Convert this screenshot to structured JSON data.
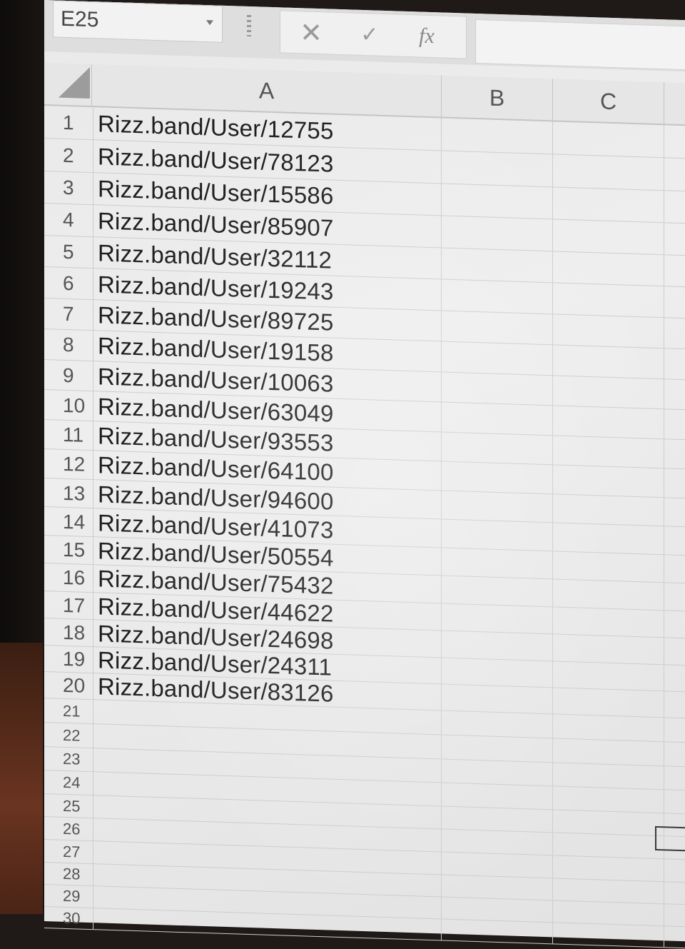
{
  "formula_bar": {
    "name_box": "E25",
    "fx_label": "fx",
    "formula_value": ""
  },
  "columns": [
    "A",
    "B",
    "C"
  ],
  "rows": [
    {
      "num": "1",
      "a": "Rizz.band/User/12755"
    },
    {
      "num": "2",
      "a": "Rizz.band/User/78123"
    },
    {
      "num": "3",
      "a": "Rizz.band/User/15586"
    },
    {
      "num": "4",
      "a": "Rizz.band/User/85907"
    },
    {
      "num": "5",
      "a": "Rizz.band/User/32112"
    },
    {
      "num": "6",
      "a": "Rizz.band/User/19243"
    },
    {
      "num": "7",
      "a": "Rizz.band/User/89725"
    },
    {
      "num": "8",
      "a": "Rizz.band/User/19158"
    },
    {
      "num": "9",
      "a": "Rizz.band/User/10063"
    },
    {
      "num": "10",
      "a": "Rizz.band/User/63049"
    },
    {
      "num": "11",
      "a": "Rizz.band/User/93553"
    },
    {
      "num": "12",
      "a": "Rizz.band/User/64100"
    },
    {
      "num": "13",
      "a": "Rizz.band/User/94600"
    },
    {
      "num": "14",
      "a": "Rizz.band/User/41073"
    },
    {
      "num": "15",
      "a": "Rizz.band/User/50554"
    },
    {
      "num": "16",
      "a": "Rizz.band/User/75432"
    },
    {
      "num": "17",
      "a": "Rizz.band/User/44622"
    },
    {
      "num": "18",
      "a": "Rizz.band/User/24698"
    },
    {
      "num": "19",
      "a": "Rizz.band/User/24311"
    },
    {
      "num": "20",
      "a": "Rizz.band/User/83126"
    },
    {
      "num": "21",
      "a": ""
    },
    {
      "num": "22",
      "a": ""
    },
    {
      "num": "23",
      "a": ""
    },
    {
      "num": "24",
      "a": ""
    },
    {
      "num": "25",
      "a": ""
    },
    {
      "num": "26",
      "a": ""
    },
    {
      "num": "27",
      "a": ""
    },
    {
      "num": "28",
      "a": ""
    },
    {
      "num": "29",
      "a": ""
    },
    {
      "num": "30",
      "a": ""
    }
  ]
}
